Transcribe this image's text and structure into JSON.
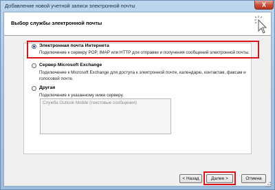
{
  "window": {
    "title": "Добавление новой учетной записи электронной почты",
    "close_label": "X"
  },
  "header": {
    "title": "Выбор службы электронной почты"
  },
  "options": [
    {
      "label": "Электронная почта Интернета",
      "description": [
        "Подключение к серверу POP, IMAP или HTTP для отправки и получения сообщений электронной почты."
      ],
      "selected": true
    },
    {
      "label": "Сервер Microsoft Exchange",
      "description": [
        "Подключение к Microsoft Exchange для доступа к электронной почте, календарю, контактам, факсам и",
        "голосовой почте."
      ],
      "selected": false
    },
    {
      "label": "Другая",
      "description": [
        "Подключение к указанному ниже серверу."
      ],
      "selected": false
    }
  ],
  "service_list": {
    "items": [
      "Служба Outlook Mobile (текстовые сообщения)"
    ]
  },
  "buttons": {
    "back": "< Назад",
    "next": "Далее >",
    "cancel": "Отмена"
  },
  "icons": {
    "close": "close-icon",
    "cursor": "cursor-click-icon",
    "grip": "resize-grip-icon"
  },
  "colors": {
    "highlight": "#d8121b",
    "accent": "#2b4f7a"
  }
}
